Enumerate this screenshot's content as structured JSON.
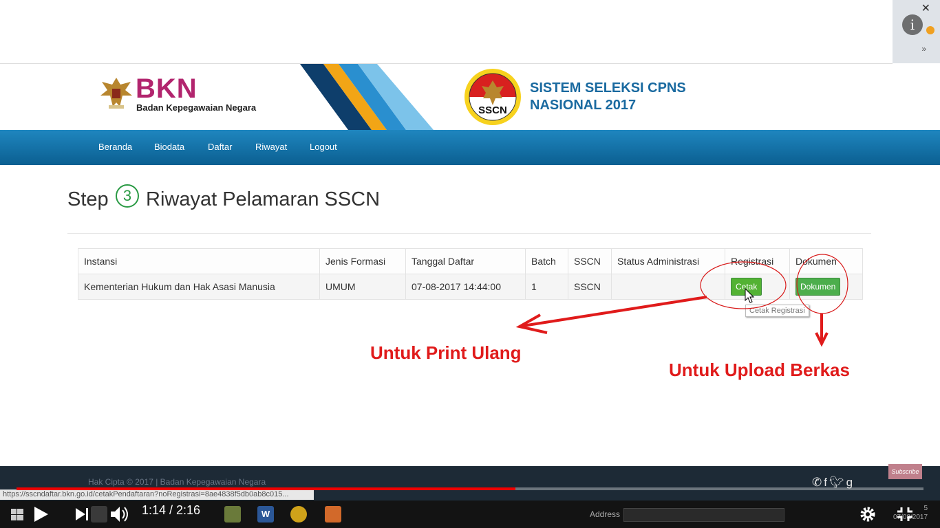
{
  "site": {
    "logo_text": "BKN",
    "logo_subtitle": "Badan Kepegawaian Negara",
    "sscn_logo_text": "SSCN",
    "title_line1": "SISTEM SELEKSI CPNS",
    "title_line2": "NASIONAL 2017"
  },
  "nav": {
    "items": [
      "Beranda",
      "Biodata",
      "Daftar",
      "Riwayat",
      "Logout"
    ]
  },
  "page": {
    "step_label": "Step",
    "step_number": "3",
    "title": "Riwayat Pelamaran SSCN"
  },
  "table": {
    "headers": [
      "Instansi",
      "Jenis Formasi",
      "Tanggal Daftar",
      "Batch",
      "SSCN",
      "Status Administrasi",
      "Registrasi",
      "Dokumen"
    ],
    "rows": [
      {
        "instansi": "Kementerian Hukum dan Hak Asasi Manusia",
        "jenis_formasi": "UMUM",
        "tanggal_daftar": "07-08-2017 14:44:00",
        "batch": "1",
        "sscn": "SSCN",
        "status_administrasi": "",
        "registrasi_button": "Cetak",
        "dokumen_button": "Dokumen"
      }
    ]
  },
  "tooltip": "Cetak Registrasi",
  "annotations": {
    "print_label": "Untuk Print Ulang",
    "upload_label": "Untuk Upload Berkas",
    "color": "#e01b1b"
  },
  "footer": {
    "copyright": "Hak Cipta © 2017 | Badan Kepegawaian Negara"
  },
  "status_url": "https://sscndaftar.bkn.go.id/cetakPendaftaran?noRegistrasi=8ae4838f5db0ab8c015...",
  "video": {
    "current_time": "1:14",
    "duration": "2:16",
    "time_display": "1:14 / 2:16",
    "progress": 0.55,
    "subscribe_label": "Subscribe"
  },
  "taskbar": {
    "address_label": "Address",
    "clock_time": "5",
    "clock_date": "07/08/2017"
  }
}
